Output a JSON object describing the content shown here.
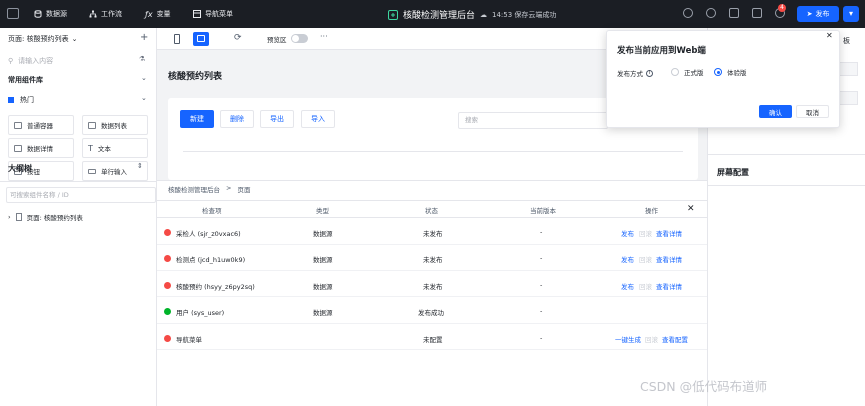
{
  "topbar": {
    "menu": [
      {
        "label": "数据源",
        "icon": "database-icon"
      },
      {
        "label": "工作流",
        "icon": "workflow-icon"
      },
      {
        "label": "变量",
        "icon": "fx-icon"
      },
      {
        "label": "导航菜单",
        "icon": "menu-icon"
      }
    ],
    "app_title": "核酸检测管理后台",
    "save_status": "14:53 保存云端成功",
    "notification_count": "4",
    "publish_label": "发布"
  },
  "sidebar": {
    "page_label": "页面: 核酸预约列表",
    "search_placeholder": "请输入内容",
    "component_library": "常用组件库",
    "hot_label": "热门",
    "components": [
      "普通容器",
      "数据列表",
      "数据详情",
      "文本",
      "按钮",
      "单行输入"
    ],
    "outline_title": "大纲树",
    "outline_search_placeholder": "可搜索组件名称 / ID",
    "tree_item": "页面: 核酸预约列表"
  },
  "toolbar": {
    "preview_label": "预览区",
    "more": "···"
  },
  "canvas": {
    "page_title": "核酸预约列表",
    "buttons": [
      "新建",
      "删除",
      "导出",
      "导入"
    ],
    "search_placeholder": "搜索"
  },
  "panel": {
    "breadcrumb": [
      "核酸检测管理后台",
      ">",
      "页面"
    ],
    "headers": [
      "检查项",
      "类型",
      "状态",
      "当前版本",
      "操作"
    ],
    "rows": [
      {
        "name": "采检人 (sjr_z0vxac6)",
        "type": "数据源",
        "status": "未发布",
        "version": "-",
        "ops": [
          "发布",
          "回滚",
          "查看详情"
        ],
        "state": "error"
      },
      {
        "name": "检测点 (jcd_h1uw0k9)",
        "type": "数据源",
        "status": "未发布",
        "version": "-",
        "ops": [
          "发布",
          "回滚",
          "查看详情"
        ],
        "state": "error"
      },
      {
        "name": "核酸预约 (hsyy_z6py2sq)",
        "type": "数据源",
        "status": "未发布",
        "version": "-",
        "ops": [
          "发布",
          "回滚",
          "查看详情"
        ],
        "state": "error"
      },
      {
        "name": "用户 (sys_user)",
        "type": "数据源",
        "status": "发布成功",
        "version": "-",
        "ops": [],
        "state": "ok"
      },
      {
        "name": "导航菜单",
        "type": "",
        "status": "未配置",
        "version": "-",
        "ops": [
          "一键生成",
          "回滚",
          "查看配置"
        ],
        "state": "error"
      }
    ]
  },
  "right_panel": {
    "screen_config": "屏幕配置",
    "edge_label": "板"
  },
  "popover": {
    "title": "发布当前应用到Web端",
    "method_label": "发布方式",
    "options": [
      "正式版",
      "体验版"
    ],
    "selected": "体验版",
    "confirm": "确认",
    "cancel": "取消"
  },
  "watermark": "CSDN @低代码布道师",
  "colors": {
    "accent": "#1664ff",
    "error": "#f54a45",
    "success": "#00b42a",
    "topbar": "#1b1e24"
  }
}
